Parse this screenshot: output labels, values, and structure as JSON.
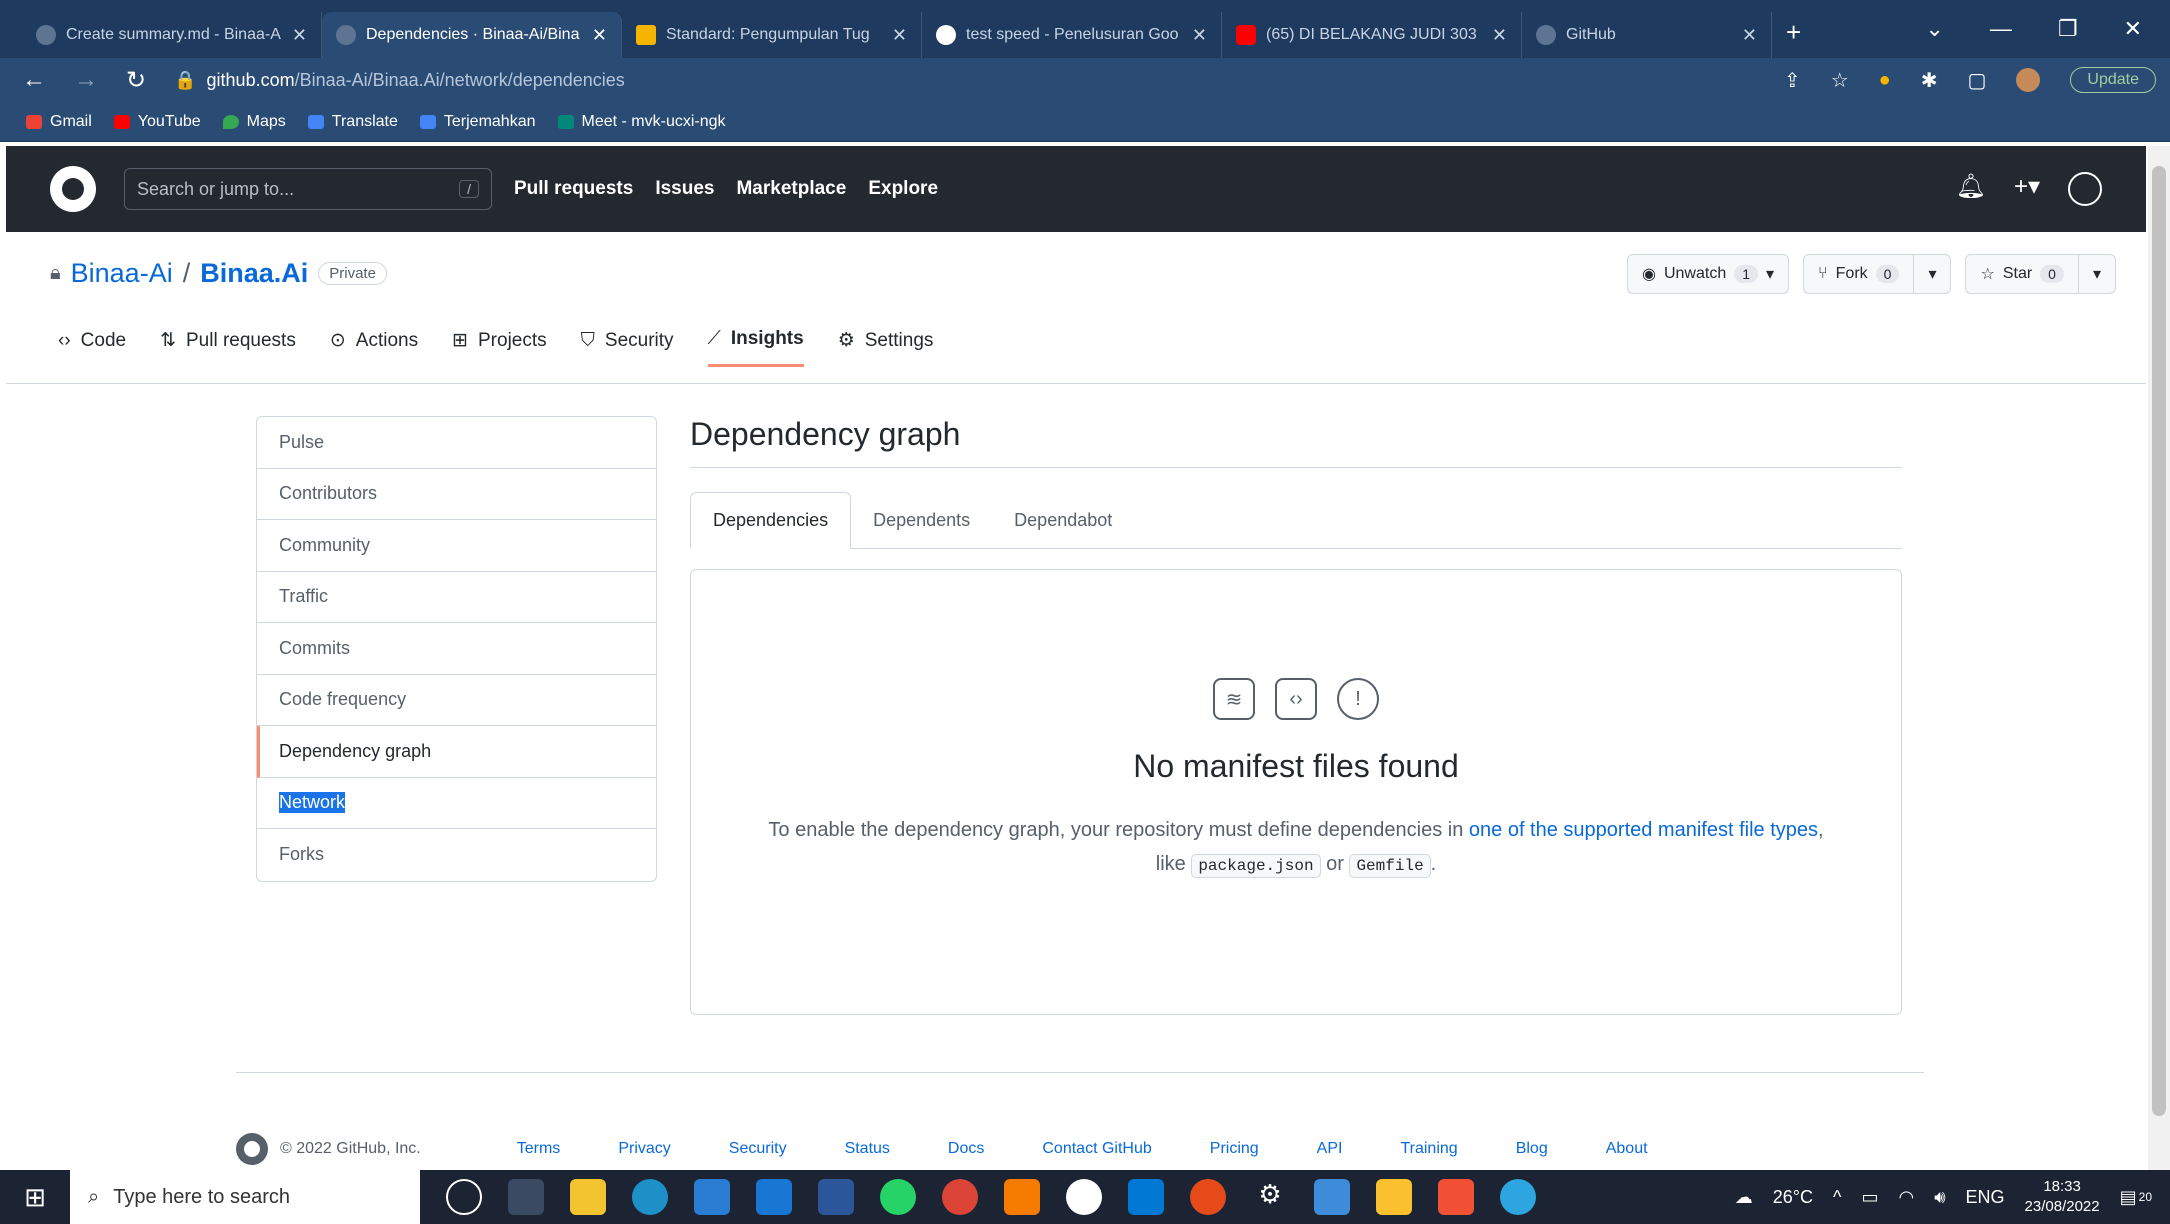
{
  "browser": {
    "tabs": [
      {
        "title": "Create summary.md - Binaa-A",
        "active": false
      },
      {
        "title": "Dependencies · Binaa-Ai/Bina",
        "active": true
      },
      {
        "title": "Standard: Pengumpulan Tug",
        "active": false
      },
      {
        "title": "test speed - Penelusuran Goo",
        "active": false
      },
      {
        "title": "(65) DI BELAKANG JUDI 303",
        "active": false
      },
      {
        "title": "GitHub",
        "active": false
      }
    ],
    "url_host": "github.com",
    "url_path": "/Binaa-Ai/Binaa.Ai/network/dependencies",
    "update_label": "Update",
    "bookmarks": [
      {
        "label": "Gmail",
        "color": "#ea4335"
      },
      {
        "label": "YouTube",
        "color": "#ff0000"
      },
      {
        "label": "Maps",
        "color": "#34a853"
      },
      {
        "label": "Translate",
        "color": "#4285f4"
      },
      {
        "label": "Terjemahkan",
        "color": "#4285f4"
      },
      {
        "label": "Meet - mvk-ucxi-ngk",
        "color": "#00897b"
      }
    ]
  },
  "github": {
    "search_placeholder": "Search or jump to...",
    "search_shortcut": "/",
    "nav": [
      "Pull requests",
      "Issues",
      "Marketplace",
      "Explore"
    ]
  },
  "repo": {
    "owner": "Binaa-Ai",
    "separator": "/",
    "name": "Binaa.Ai",
    "visibility": "Private",
    "unwatch_label": "Unwatch",
    "unwatch_count": "1",
    "fork_label": "Fork",
    "fork_count": "0",
    "star_label": "Star",
    "star_count": "0",
    "tabs": [
      {
        "label": "Code",
        "icon": "code-icon"
      },
      {
        "label": "Pull requests",
        "icon": "pull-request-icon"
      },
      {
        "label": "Actions",
        "icon": "play-icon"
      },
      {
        "label": "Projects",
        "icon": "table-icon"
      },
      {
        "label": "Security",
        "icon": "shield-icon"
      },
      {
        "label": "Insights",
        "icon": "graph-icon",
        "active": true
      },
      {
        "label": "Settings",
        "icon": "gear-icon"
      }
    ]
  },
  "sidebar": {
    "items": [
      {
        "label": "Pulse"
      },
      {
        "label": "Contributors"
      },
      {
        "label": "Community"
      },
      {
        "label": "Traffic"
      },
      {
        "label": "Commits"
      },
      {
        "label": "Code frequency"
      },
      {
        "label": "Dependency graph",
        "current": true
      },
      {
        "label": "Network",
        "selected_text": true
      },
      {
        "label": "Forks"
      }
    ]
  },
  "main": {
    "title": "Dependency graph",
    "tabs": [
      "Dependencies",
      "Dependents",
      "Dependabot"
    ],
    "blankslate_title": "No manifest files found",
    "blankslate_text_before": "To enable the dependency graph, your repository must define dependencies in ",
    "blankslate_link": "one of the supported manifest file types",
    "blankslate_text_like": ", like ",
    "code_1": "package.json",
    "text_or": " or ",
    "code_2": "Gemfile",
    "text_end": "."
  },
  "footer": {
    "copyright": "© 2022 GitHub, Inc.",
    "links": [
      "Terms",
      "Privacy",
      "Security",
      "Status",
      "Docs",
      "Contact GitHub",
      "Pricing",
      "API",
      "Training",
      "Blog",
      "About"
    ]
  },
  "taskbar": {
    "search_placeholder": "Type here to search",
    "temperature": "26°C",
    "language": "ENG",
    "time": "18:33",
    "date": "23/08/2022",
    "notifications": "20"
  }
}
